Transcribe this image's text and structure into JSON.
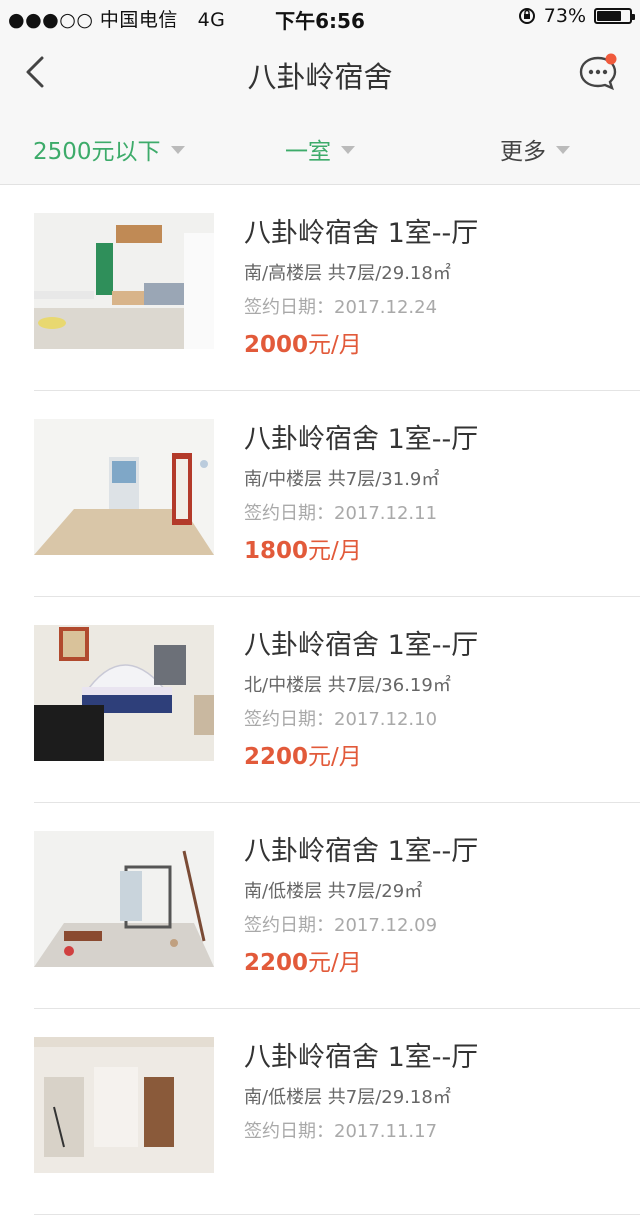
{
  "status_bar": {
    "carrier": "●●●○○ 中国电信",
    "network": "4G",
    "time": "下午6:56",
    "battery": "73%",
    "battery_level": 0.73
  },
  "nav": {
    "title": "八卦岭宿舍"
  },
  "filters": [
    {
      "label": "2500元以下",
      "active": true
    },
    {
      "label": "一室",
      "active": true
    },
    {
      "label": "更多",
      "active": false
    }
  ],
  "listings": [
    {
      "title": "八卦岭宿舍 1室--厅",
      "info": "南/高楼层 共7层/29.18㎡",
      "date": "签约日期：2017.12.24",
      "price": "2000",
      "unit": "元/月"
    },
    {
      "title": "八卦岭宿舍 1室--厅",
      "info": "南/中楼层 共7层/31.9㎡",
      "date": "签约日期：2017.12.11",
      "price": "1800",
      "unit": "元/月"
    },
    {
      "title": "八卦岭宿舍 1室--厅",
      "info": "北/中楼层 共7层/36.19㎡",
      "date": "签约日期：2017.12.10",
      "price": "2200",
      "unit": "元/月"
    },
    {
      "title": "八卦岭宿舍 1室--厅",
      "info": "南/低楼层 共7层/29㎡",
      "date": "签约日期：2017.12.09",
      "price": "2200",
      "unit": "元/月"
    },
    {
      "title": "八卦岭宿舍 1室--厅",
      "info": "南/低楼层 共7层/29.18㎡",
      "date": "签约日期：2017.11.17",
      "price": "",
      "unit": ""
    }
  ],
  "colors": {
    "accent": "#3dab6a",
    "price": "#e25a3a",
    "badge": "#f05a3c"
  }
}
